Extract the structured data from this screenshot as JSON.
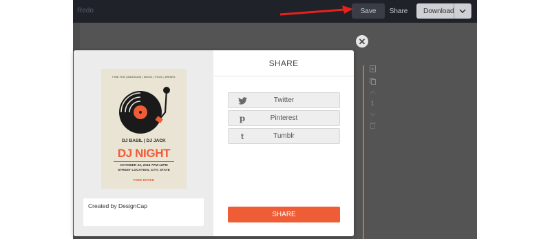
{
  "toolbar": {
    "redo_label": "Redo",
    "save_label": "Save",
    "share_label": "Share",
    "download_label": "Download",
    "download_caret": "chevron-down-icon"
  },
  "side_tools": {
    "page_number": "1",
    "icons": [
      "add-page-icon",
      "duplicate-page-icon",
      "move-up-icon",
      "move-down-icon",
      "delete-icon"
    ]
  },
  "annotation": {
    "color": "#e8211d",
    "icon": "red-arrow-pointing-right"
  },
  "modal": {
    "close_icon": "close-icon",
    "title": "SHARE",
    "social_buttons": [
      {
        "icon": "twitter-icon",
        "label": "Twitter"
      },
      {
        "icon": "pinterest-icon",
        "label": "Pinterest"
      },
      {
        "icon": "tumblr-icon",
        "label": "Tumblr"
      }
    ],
    "share_button_label": "SHARE",
    "caption": "Created by DesignCap",
    "accent_color": "#ee5d36"
  },
  "poster": {
    "tagline": "FIND FUN | BARGAINS | MUSIC | FOOD | DRINKS",
    "names": "DJ BASIL | DJ JACK",
    "title": "DJ NIGHT",
    "date": "OCTOBER 22, 2018  7PM-12PM",
    "location": "STREET LOCATION, CITY, STATE",
    "entry": "FREE ENTER",
    "background": "#eae4d5"
  }
}
